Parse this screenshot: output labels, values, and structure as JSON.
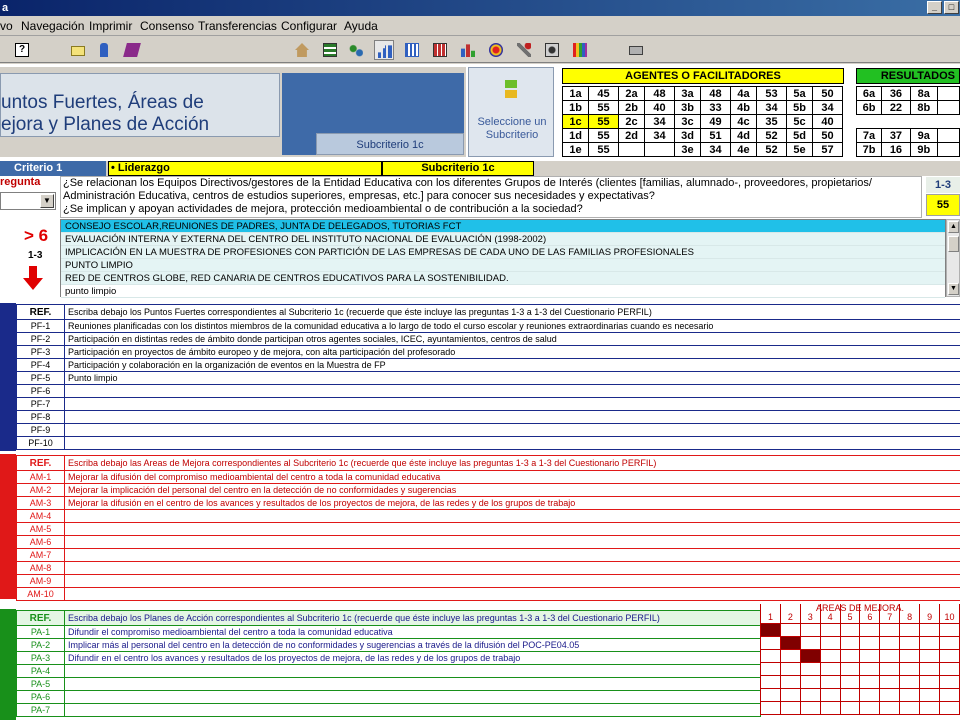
{
  "window": {
    "title": "a",
    "min_label": "_",
    "max_label": "□"
  },
  "menu": [
    "vo",
    "Navegación",
    "Imprimir",
    "Consenso",
    "Transferencias",
    "Configurar",
    "Ayuda"
  ],
  "toolbar_icons": [
    "help-icon",
    "folder-icon",
    "users-icon",
    "book-icon",
    "home-icon",
    "list-icon",
    "network-icon",
    "chart-icon",
    "report-icon",
    "grid-icon",
    "bar-chart-icon",
    "target-icon",
    "tools-icon",
    "photo-icon",
    "palette-icon",
    "print-icon"
  ],
  "header": {
    "title_line1": "untos Fuertes, Áreas de",
    "title_line2": "ejora y Planes de Acción",
    "subcriterio_box": "Subcriterio 1c",
    "select_button": "Seleccione un Subcriterio"
  },
  "agentes": {
    "title": "AGENTES O FACILITADORES",
    "rows": [
      [
        "1a",
        "45",
        "2a",
        "48",
        "3a",
        "48",
        "4a",
        "53",
        "5a",
        "50"
      ],
      [
        "1b",
        "55",
        "2b",
        "40",
        "3b",
        "33",
        "4b",
        "34",
        "5b",
        "34"
      ],
      [
        "1c",
        "55",
        "2c",
        "34",
        "3c",
        "49",
        "4c",
        "35",
        "5c",
        "40"
      ],
      [
        "1d",
        "55",
        "2d",
        "34",
        "3d",
        "51",
        "4d",
        "52",
        "5d",
        "50"
      ],
      [
        "1e",
        "55",
        "",
        "",
        "3e",
        "34",
        "4e",
        "52",
        "5e",
        "57"
      ]
    ]
  },
  "resultados": {
    "title": "RESULTADOS",
    "rows": [
      [
        "6a",
        "36",
        "8a",
        ""
      ],
      [
        "6b",
        "22",
        "8b",
        ""
      ],
      [
        "",
        "",
        "",
        ""
      ],
      [
        "7a",
        "37",
        "9a",
        ""
      ],
      [
        "7b",
        "16",
        "9b",
        ""
      ]
    ]
  },
  "criterio": {
    "label": "Criterio  1",
    "name": "• Liderazgo",
    "subcriterio": "Subcriterio 1c"
  },
  "pregunta": {
    "label": "regunta",
    "lines": [
      "¿Se relacionan los Equipos Directivos/gestores de la Entidad Educativa con los diferentes Grupos de Interés (clientes [familias, alumnado-, proveedores, propietarios/",
      "Administración Educativa, centros de estudios superiores, empresas, etc.] para conocer sus necesidades y expectativas?",
      "¿Se implican y apoyan actividades de mejora, protección medioambiental o de contribución a la sociedad?"
    ],
    "range": "1-3",
    "score": "55"
  },
  "indicador": {
    "threshold": "> 6",
    "range": "1-3"
  },
  "evidencias": [
    "CONSEJO ESCOLAR,REUNIONES DE PADRES, JUNTA DE DELEGADOS, TUTORIAS FCT",
    "EVALUACIÓN INTERNA Y EXTERNA DEL CENTRO DEL INSTITUTO NACIONAL DE EVALUACIÓN (1998-2002)",
    "IMPLICACIÓN EN LA MUESTRA DE PROFESIONES CON PARTICIÓN DE LAS EMPRESAS DE CADA UNO DE LAS FAMILIAS PROFESIONALES",
    "PUNTO LIMPIO",
    "RED DE CENTROS GLOBE, RED CANARIA DE CENTROS EDUCATIVOS PARA LA SOSTENIBILIDAD.",
    "punto limpio"
  ],
  "puntos_fuertes": {
    "ref_header": "REF.",
    "header": "Escriba debajo los Puntos Fuertes correspondientes al Subcriterio 1c (recuerde que éste incluye las preguntas 1-3 a 1-3 del Cuestionario PERFIL)",
    "rows": [
      {
        "ref": "PF-1",
        "text": "Reuniones planificadas con los distintos miembros de la comunidad educativa a lo largo de todo el curso escolar y reuniones extraordinarias cuando es necesario"
      },
      {
        "ref": "PF-2",
        "text": "Participación en distintas redes de ámbito donde participan otros agentes sociales, ICEC, ayuntamientos, centros de salud"
      },
      {
        "ref": "PF-3",
        "text": "Participación en proyectos de ámbito europeo y de mejora, con alta participación del profesorado"
      },
      {
        "ref": "PF-4",
        "text": "Participación y colaboración en la organización de eventos en la Muestra de FP"
      },
      {
        "ref": "PF-5",
        "text": "Punto limpio"
      },
      {
        "ref": "PF-6",
        "text": ""
      },
      {
        "ref": "PF-7",
        "text": ""
      },
      {
        "ref": "PF-8",
        "text": ""
      },
      {
        "ref": "PF-9",
        "text": ""
      },
      {
        "ref": "PF-10",
        "text": ""
      }
    ]
  },
  "areas_mejora": {
    "ref_header": "REF.",
    "header": "Escriba debajo las Areas de Mejora correspondientes al Subcriterio 1c (recuerde que éste incluye las preguntas 1-3 a 1-3 del Cuestionario PERFIL)",
    "rows": [
      {
        "ref": "AM-1",
        "text": "Mejorar la difusión del compromiso medioambiental del centro a toda la comunidad educativa"
      },
      {
        "ref": "AM-2",
        "text": "Mejorar la implicación del personal del centro en la detección de no conformidades y sugerencias"
      },
      {
        "ref": "AM-3",
        "text": "Mejorar la difusión en el centro de los avances y resultados de los proyectos de mejora, de las redes y de los grupos de trabajo"
      },
      {
        "ref": "AM-4",
        "text": ""
      },
      {
        "ref": "AM-5",
        "text": ""
      },
      {
        "ref": "AM-6",
        "text": ""
      },
      {
        "ref": "AM-7",
        "text": ""
      },
      {
        "ref": "AM-8",
        "text": ""
      },
      {
        "ref": "AM-9",
        "text": ""
      },
      {
        "ref": "AM-10",
        "text": ""
      }
    ]
  },
  "planes_accion": {
    "ref_header": "REF.",
    "header": "Escriba debajo los Planes de Acción correspondientes al Subcriterio 1c (recuerde que éste incluye las preguntas 1-3 a 1-3 del Cuestionario PERFIL)",
    "rows": [
      {
        "ref": "PA-1",
        "text": "Difundir el compromiso medioambiental del centro a toda la comunidad educativa"
      },
      {
        "ref": "PA-2",
        "text": "Implicar más al personal del centro en la detección de no conformidades y sugerencias a través de la difusión del POC-PE04.05"
      },
      {
        "ref": "PA-3",
        "text": "Difundir en el centro los avances y resultados de los proyectos de mejora, de las redes y de los grupos de trabajo"
      },
      {
        "ref": "PA-4",
        "text": ""
      },
      {
        "ref": "PA-5",
        "text": ""
      },
      {
        "ref": "PA-6",
        "text": ""
      },
      {
        "ref": "PA-7",
        "text": ""
      }
    ],
    "areas_title": "AREAS DE MEJORA.",
    "areas_cols": [
      "1",
      "2",
      "3",
      "4",
      "5",
      "6",
      "7",
      "8",
      "9",
      "10"
    ],
    "areas_marks": [
      [
        1
      ],
      [
        2
      ],
      [
        3
      ]
    ]
  },
  "colors": {
    "pf": "#1a2a8a",
    "am": "#e01818",
    "pa": "#18901a",
    "accent": "#3e6aa8"
  }
}
